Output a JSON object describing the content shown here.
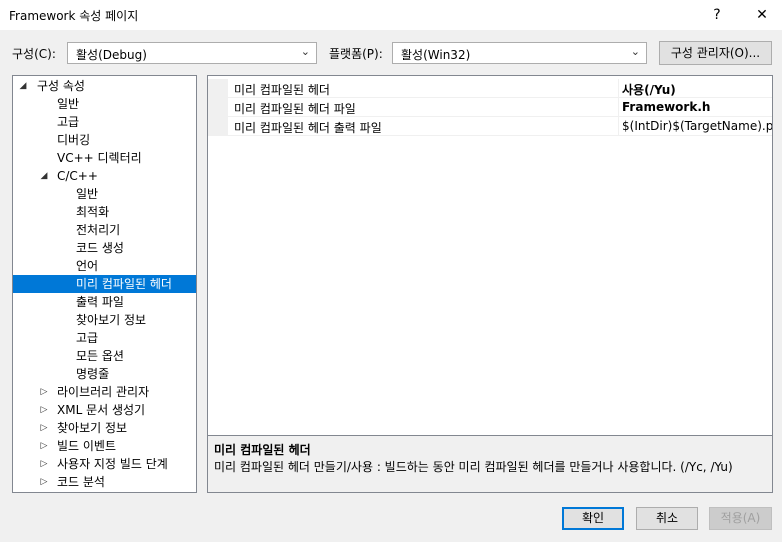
{
  "window": {
    "title": "Framework 속성 페이지",
    "help_label": "?",
    "close_label": "✕"
  },
  "config": {
    "configuration_label": "구성(C):",
    "configuration_value": "활성(Debug)",
    "platform_label": "플랫폼(P):",
    "platform_value": "활성(Win32)",
    "manager_button": "구성 관리자(O)..."
  },
  "tree": {
    "root": "구성 속성",
    "general": "일반",
    "advanced": "고급",
    "debugging": "디버깅",
    "vc_dirs": "VC++ 디렉터리",
    "cpp": "C/C++",
    "cpp_general": "일반",
    "cpp_optimization": "최적화",
    "cpp_preprocessor": "전처리기",
    "cpp_codegen": "코드 생성",
    "cpp_language": "언어",
    "cpp_pch": "미리 컴파일된 헤더",
    "cpp_output": "출력 파일",
    "cpp_browse": "찾아보기 정보",
    "cpp_advanced": "고급",
    "cpp_all": "모든 옵션",
    "cpp_cmdline": "명령줄",
    "librarian": "라이브러리 관리자",
    "xml_doc": "XML 문서 생성기",
    "browse_info": "찾아보기 정보",
    "build_events": "빌드 이벤트",
    "custom_build": "사용자 지정 빌드 단계",
    "code_analysis": "코드 분석"
  },
  "properties": [
    {
      "name": "미리 컴파일된 헤더",
      "value": "사용(/Yu)"
    },
    {
      "name": "미리 컴파일된 헤더 파일",
      "value": "Framework.h"
    },
    {
      "name": "미리 컴파일된 헤더 출력 파일",
      "value": "$(IntDir)$(TargetName).pch"
    }
  ],
  "description": {
    "title": "미리 컴파일된 헤더",
    "text": "미리 컴파일된 헤더 만들기/사용 : 빌드하는 동안 미리 컴파일된 헤더를 만들거나 사용합니다.     (/Yc, /Yu)"
  },
  "buttons": {
    "ok": "확인",
    "cancel": "취소",
    "apply": "적용(A)"
  },
  "colors": {
    "selection": "#0078d7",
    "ok_border": "#0078d7",
    "disabled_text": "#a0a0a0"
  }
}
